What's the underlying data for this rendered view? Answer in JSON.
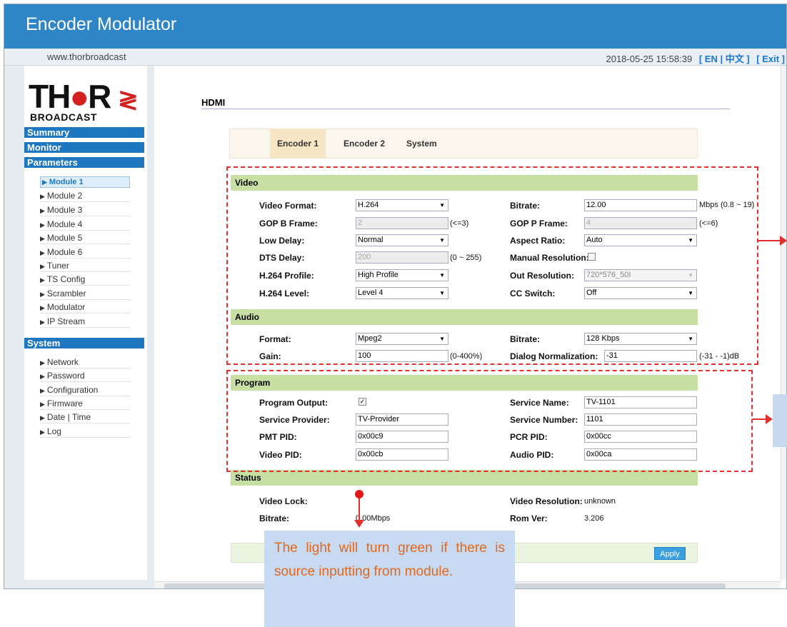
{
  "header": {
    "title": "Encoder Modulator",
    "url": "www.thorbroadcast",
    "datetime": "2018-05-25 15:58:39",
    "lang_label": "[ EN | 中文 ]",
    "exit_label": "[ Exit ]"
  },
  "logo": {
    "top": "TH R",
    "bottom": "BROADCAST"
  },
  "sidebar": {
    "summary": "Summary",
    "monitor": "Monitor",
    "parameters": "Parameters",
    "modules": [
      "Module 1",
      "Module 2",
      "Module 3",
      "Module 4",
      "Module 5",
      "Module 6",
      "Tuner",
      "TS Config",
      "Scrambler",
      "Modulator",
      "IP Stream"
    ],
    "system": "System",
    "system_items": [
      "Network",
      "Password",
      "Configuration",
      "Firmware",
      "Date | Time",
      "Log"
    ]
  },
  "page": {
    "title": "HDMI"
  },
  "tabs": [
    "Encoder 1",
    "Encoder 2",
    "System"
  ],
  "video": {
    "section": "Video",
    "format_label": "Video Format:",
    "format_value": "H.264",
    "bitrate_label": "Bitrate:",
    "bitrate_value": "12.00",
    "bitrate_hint": "Mbps (0.8 ~ 19)",
    "gopb_label": "GOP B Frame:",
    "gopb_value": "2",
    "gopb_hint": "(<=3)",
    "gopp_label": "GOP P Frame:",
    "gopp_value": "4",
    "gopp_hint": "(<=6)",
    "lowdelay_label": "Low Delay:",
    "lowdelay_value": "Normal",
    "aspect_label": "Aspect Ratio:",
    "aspect_value": "Auto",
    "dts_label": "DTS Delay:",
    "dts_value": "200",
    "dts_hint": "(0 ~ 255)",
    "manual_label": "Manual Resolution:",
    "profile_label": "H.264 Profile:",
    "profile_value": "High Profile",
    "outres_label": "Out Resolution:",
    "outres_value": "720*576_50I",
    "level_label": "H.264 Level:",
    "level_value": "Level 4",
    "cc_label": "CC Switch:",
    "cc_value": "Off"
  },
  "audio": {
    "section": "Audio",
    "format_label": "Format:",
    "format_value": "Mpeg2",
    "bitrate_label": "Bitrate:",
    "bitrate_value": "128 Kbps",
    "gain_label": "Gain:",
    "gain_value": "100",
    "gain_hint": "(0-400%)",
    "dialog_label": "Dialog Normalization:",
    "dialog_value": "-31",
    "dialog_hint": "(-31 - -1)dB"
  },
  "program": {
    "section": "Program",
    "output_label": "Program Output:",
    "service_name_label": "Service Name:",
    "service_name_value": "TV-1101",
    "provider_label": "Service Provider:",
    "provider_value": "TV-Provider",
    "service_number_label": "Service Number:",
    "service_number_value": "1101",
    "pmt_label": "PMT PID:",
    "pmt_value": "0x00c9",
    "pcr_label": "PCR PID:",
    "pcr_value": "0x00cc",
    "video_pid_label": "Video PID:",
    "video_pid_value": "0x00cb",
    "audio_pid_label": "Audio PID:",
    "audio_pid_value": "0x00ca"
  },
  "status": {
    "section": "Status",
    "lock_label": "Video Lock:",
    "res_label": "Video Resolution:",
    "res_value": "unknown",
    "bitrate_label": "Bitrate:",
    "bitrate_value": "0.00Mbps",
    "rom_label": "Rom Ver:",
    "rom_value": "3.206"
  },
  "apply_label": "Apply",
  "callout": "The light will turn green if there is source inputting from module."
}
